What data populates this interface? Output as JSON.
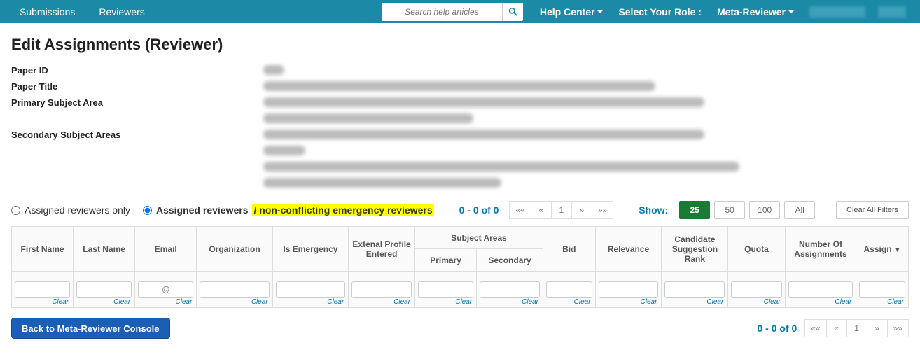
{
  "nav": {
    "submissions": "Submissions",
    "reviewers": "Reviewers",
    "search_placeholder": "Search help articles",
    "help_center": "Help Center",
    "select_role": "Select Your Role :",
    "role": "Meta-Reviewer"
  },
  "page": {
    "title": "Edit Assignments (Reviewer)"
  },
  "meta": {
    "paper_id_label": "Paper ID",
    "paper_title_label": "Paper Title",
    "primary_area_label": "Primary Subject Area",
    "secondary_areas_label": "Secondary Subject Areas"
  },
  "radios": {
    "assigned_only": "Assigned reviewers only",
    "assigned_and": "Assigned reviewers",
    "emergency_suffix": "/ non-conflicting emergency reviewers"
  },
  "paging": {
    "count_text": "0 - 0 of 0",
    "first": "««",
    "prev": "«",
    "page": "1",
    "next": "»",
    "last": "»»"
  },
  "show": {
    "label": "Show:",
    "opt25": "25",
    "opt50": "50",
    "opt100": "100",
    "optAll": "All"
  },
  "buttons": {
    "clear_all": "Clear All Filters",
    "back": "Back to Meta-Reviewer Console",
    "clear": "Clear"
  },
  "columns": {
    "first_name": "First Name",
    "last_name": "Last Name",
    "email": "Email",
    "organization": "Organization",
    "is_emergency": "Is Emergency",
    "external_profile": "Extenal Profile Entered",
    "subject_areas": "Subject Areas",
    "primary": "Primary",
    "secondary": "Secondary",
    "bid": "Bid",
    "relevance": "Relevance",
    "candidate_rank": "Candidate Suggestion Rank",
    "quota": "Quota",
    "num_assignments": "Number Of Assignments",
    "assign": "Assign"
  },
  "filters": {
    "email_placeholder": "@"
  }
}
